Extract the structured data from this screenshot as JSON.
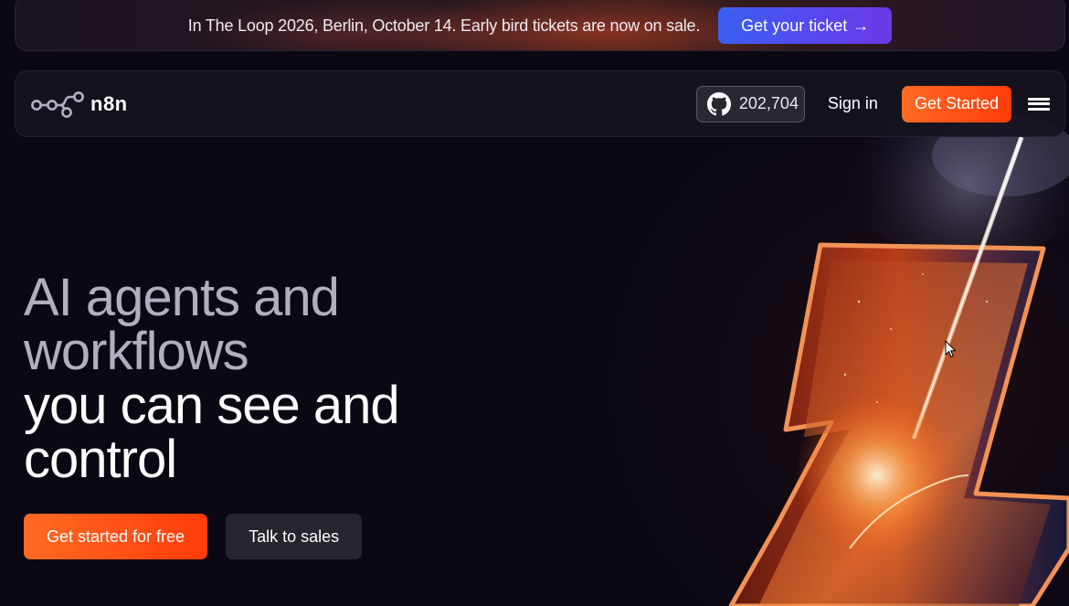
{
  "banner": {
    "text": "In The Loop 2026, Berlin, October 14. Early bird tickets are now on sale.",
    "cta_label": "Get your ticket",
    "cta_arrow": "→"
  },
  "navbar": {
    "logo_text": "n8n",
    "github_stars": "202,704",
    "signin_label": "Sign in",
    "cta_label": "Get Started"
  },
  "hero": {
    "headline_muted_line1": "AI agents and",
    "headline_muted_line2": "workflows",
    "headline_bright_line1": "you can see and",
    "headline_bright_line2": "control",
    "primary_cta": "Get started for free",
    "secondary_cta": "Talk to sales"
  },
  "colors": {
    "background": "#0b0814",
    "accent_orange": "#ff4a12",
    "ticket_blue": "#4a52ee",
    "muted_text": "#b3aebb"
  }
}
